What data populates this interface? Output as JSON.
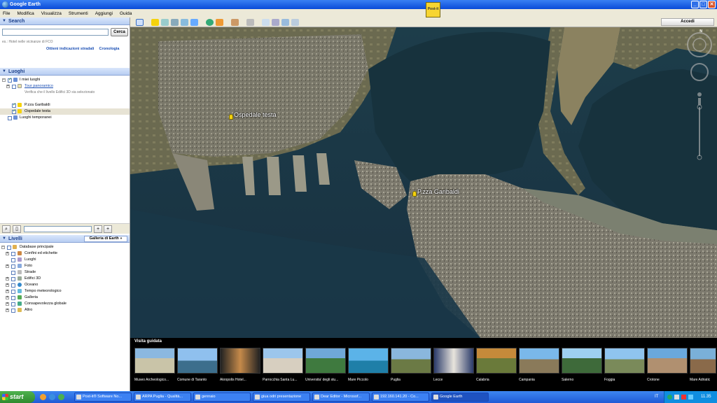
{
  "window": {
    "title": "Google Earth",
    "min": "_",
    "max": "□",
    "close": "✕"
  },
  "menu": [
    "File",
    "Modifica",
    "Visualizza",
    "Strumenti",
    "Aggiungi",
    "Guida"
  ],
  "postit_label": "Post-it",
  "search": {
    "header": "Search",
    "placeholder": "",
    "button": "Cerca",
    "hint": "es.: Hotel nelle vicinanze di FCO",
    "link_directions": "Ottieni indicazioni stradali",
    "link_history": "Cronologia"
  },
  "places": {
    "header": "Luoghi",
    "items": [
      {
        "label": "I miei luoghi",
        "level": 0,
        "checked": true
      },
      {
        "label": "Tour panoramico",
        "level": 1,
        "checked": false,
        "link": true
      },
      {
        "label": "Verifica che il livello Edifici 3D sia selezionato",
        "level": 2,
        "note": true
      },
      {
        "label": "P.zza Garibaldi",
        "level": 1,
        "checked": true
      },
      {
        "label": "Ospedale testa",
        "level": 1,
        "checked": true,
        "selected": true
      },
      {
        "label": "Luoghi temporanei",
        "level": 0,
        "checked": false
      }
    ]
  },
  "layers": {
    "header": "Livelli",
    "gallery_button": "Galleria di Earth »",
    "items": [
      "Database principale",
      "Confini ed etichette",
      "Luoghi",
      "Foto",
      "Strade",
      "Edifici 3D",
      "Oceano",
      "Tempo meteorologico",
      "Galleria",
      "Consapevolezza globale",
      "Altro"
    ]
  },
  "toolbar": {
    "signin": "Accedi"
  },
  "map": {
    "label_hospital": "Ospedale testa",
    "label_square": "P.zza Garibaldi",
    "compass_n": "N"
  },
  "tour": {
    "title": "Visita guidata",
    "items": [
      "Museo Archeologico...",
      "Comune di Taranto",
      "Akropolis Hotel...",
      "Parrocchia Santa Lu...",
      "Universita' degli stu...",
      "Mare Piccolo",
      "Puglia",
      "Lecce",
      "Calabria",
      "Campania",
      "Salerno",
      "Foggia",
      "Crotone",
      "Mare Adriatic"
    ]
  },
  "taskbar": {
    "start": "start",
    "tasks": [
      "Post-it® Software No...",
      "ARPA Puglia - Qualità...",
      "gennaio",
      "giua odri presentazione",
      "Dear Editor - Microsof...",
      "192.160.141.20 - Co...",
      "Google Earth"
    ],
    "lang": "IT",
    "clock": "11.35"
  }
}
